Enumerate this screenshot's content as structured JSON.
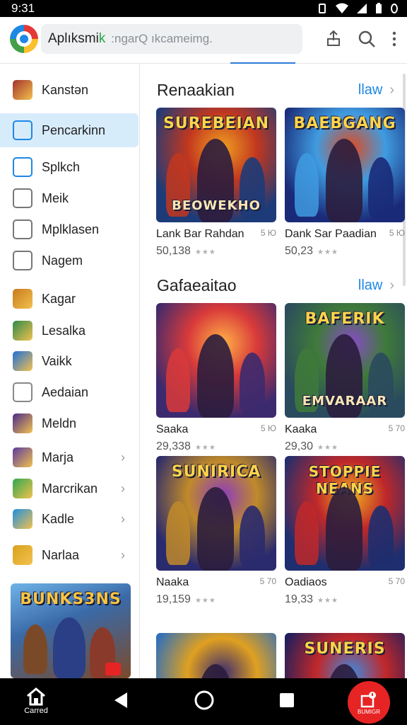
{
  "status": {
    "time": "9:31"
  },
  "appbar": {
    "brand": "Aplıksmi",
    "brand_accent": "k",
    "search_placeholder": ":ngarQ ıkcameimg."
  },
  "sidebar": {
    "items": [
      {
        "label": "Kanstən",
        "icon": "game-avatar-icon",
        "color": "#a3322b",
        "chevron": false,
        "active": false
      },
      {
        "label": "Pencarkinn",
        "icon": "edit-icon",
        "color": "#1e88e5",
        "chevron": false,
        "active": true
      },
      {
        "label": "Splkch",
        "icon": "chart-icon",
        "color": "#1e88e5",
        "chevron": false,
        "active": false
      },
      {
        "label": "Meik",
        "icon": "check-box-icon",
        "color": "#777777",
        "chevron": false,
        "active": false
      },
      {
        "label": "Mplklasen",
        "icon": "mail-icon",
        "color": "#777777",
        "chevron": false,
        "active": false
      },
      {
        "label": "Nagem",
        "icon": "grid-icon",
        "color": "#777777",
        "chevron": false,
        "active": false
      },
      {
        "label": "Kagar",
        "icon": "game-face-icon",
        "color": "#c77b1e",
        "chevron": false,
        "active": false
      },
      {
        "label": "Lesalka",
        "icon": "game-map-icon",
        "color": "#2e8a4a",
        "chevron": false,
        "active": false
      },
      {
        "label": "Vaikk",
        "icon": "compass-icon",
        "color": "#1e6fd9",
        "chevron": false,
        "active": false
      },
      {
        "label": "Aedaian",
        "icon": "hexagon-icon",
        "color": "#888888",
        "chevron": false,
        "active": false
      },
      {
        "label": "Meldn",
        "icon": "sword-icon",
        "color": "#4a2a8a",
        "chevron": false,
        "active": false
      },
      {
        "label": "Marja",
        "icon": "game-hero-icon",
        "color": "#5a3aa0",
        "chevron": true,
        "active": false
      },
      {
        "label": "Marcrikan",
        "icon": "refresh-icon",
        "color": "#2fa84f",
        "chevron": true,
        "active": false
      },
      {
        "label": "Kadle",
        "icon": "bolt-icon",
        "color": "#1f8fe0",
        "chevron": true,
        "active": false
      },
      {
        "label": "Narlaa",
        "icon": "shield-icon",
        "color": "#d9a21e",
        "chevron": true,
        "active": false
      }
    ],
    "banner_title": "BUNKS3NS"
  },
  "sections": [
    {
      "title": "Renaakian",
      "more": "llaw",
      "cards": [
        {
          "art_title": "SUREBEIAN",
          "art_subtitle": "BEOWEKHO",
          "name": "Lank Bar Rahdan",
          "meta": "5 Ю",
          "count": "50,138",
          "colors": [
            "#1d3b78",
            "#c2371f",
            "#f0a020"
          ]
        },
        {
          "art_title": "BAEBGANG",
          "art_subtitle": "",
          "name": "Dank Sar Paadian",
          "meta": "5 Ю",
          "count": "50,23",
          "colors": [
            "#1a2a78",
            "#3f9be0",
            "#e04a1e"
          ]
        }
      ]
    },
    {
      "title": "Gafaeaitao",
      "more": "llaw",
      "cards": [
        {
          "art_title": "",
          "art_subtitle": "",
          "name": "Saaka",
          "meta": "5 Ю",
          "count": "29,338",
          "colors": [
            "#3c2a6e",
            "#d93a3a",
            "#ffb347"
          ]
        },
        {
          "art_title": "BAFERIK",
          "art_subtitle": "EMVARAAR",
          "name": "Kaaka",
          "meta": "5 70",
          "count": "29,30",
          "colors": [
            "#2a4a5e",
            "#3f7a3a",
            "#8a4acb"
          ]
        },
        {
          "art_title": "SUNIRICA",
          "art_subtitle": "",
          "name": "Naaka",
          "meta": "5 70",
          "count": "19,159",
          "colors": [
            "#2a2a6e",
            "#c08a2a",
            "#8a3ac0"
          ]
        },
        {
          "art_title": "STOPPIE NEANS",
          "art_subtitle": "",
          "name": "Oadiaos",
          "meta": "5 70",
          "count": "19,33",
          "colors": [
            "#1e2e6e",
            "#c0282a",
            "#f0b020"
          ]
        },
        {
          "art_title": "",
          "art_subtitle": "",
          "name": "",
          "meta": "",
          "count": "",
          "colors": [
            "#2a6ec0",
            "#e0a020",
            "#3a2a6e"
          ]
        },
        {
          "art_title": "SUNERIS",
          "art_subtitle": "",
          "name": "",
          "meta": "",
          "count": "",
          "colors": [
            "#1a1e5e",
            "#c0282a",
            "#3f8ae0"
          ]
        }
      ]
    }
  ],
  "navbar": {
    "home_label": "Carred",
    "fab_label": "BUMIGR"
  }
}
